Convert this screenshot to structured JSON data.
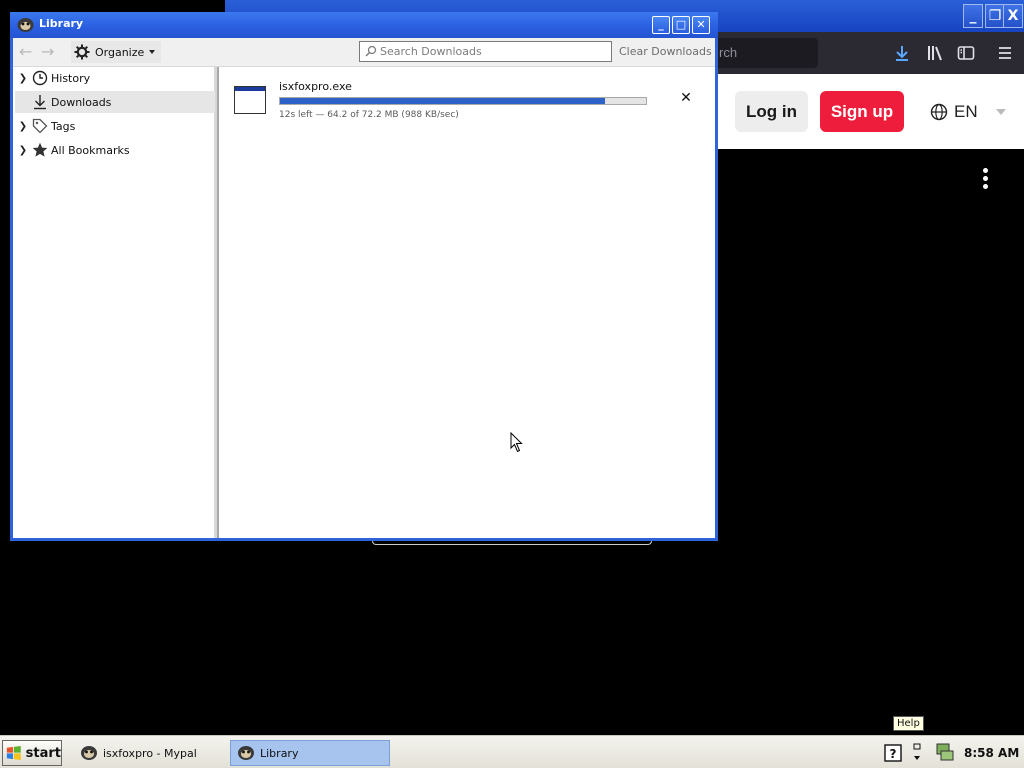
{
  "library_window": {
    "title": "Library",
    "toolbar": {
      "organize_label": "Organize",
      "search_placeholder": "Search Downloads",
      "clear_label": "Clear Downloads"
    },
    "sidebar": {
      "items": [
        {
          "label": "History",
          "icon": "clock-icon",
          "expandable": true
        },
        {
          "label": "Downloads",
          "icon": "download-icon",
          "expandable": false,
          "selected": true
        },
        {
          "label": "Tags",
          "icon": "tag-icon",
          "expandable": true
        },
        {
          "label": "All Bookmarks",
          "icon": "star-icon",
          "expandable": true
        }
      ]
    },
    "downloads": [
      {
        "filename": "isxfoxpro.exe",
        "status": "12s left — 64.2 of 72.2 MB (988 KB/sec)",
        "progress_fraction": 0.889,
        "progress_color": "#2d63c8"
      }
    ]
  },
  "background_browser": {
    "search_text": "rch",
    "login_label": "Log in",
    "signup_label": "Sign up",
    "language": "EN",
    "signup_color": "#ee1d3c"
  },
  "taskbar": {
    "start_label": "start",
    "tasks": [
      {
        "label": "isxfoxpro - Mypal",
        "active": false
      },
      {
        "label": "Library",
        "active": true
      }
    ],
    "clock": "8:58 AM",
    "tooltip": "Help"
  },
  "colors": {
    "titlebar_blue": "#2e63dd",
    "taskbar_bg": "#ece9d8",
    "selected_task": "#a6c4ee"
  }
}
